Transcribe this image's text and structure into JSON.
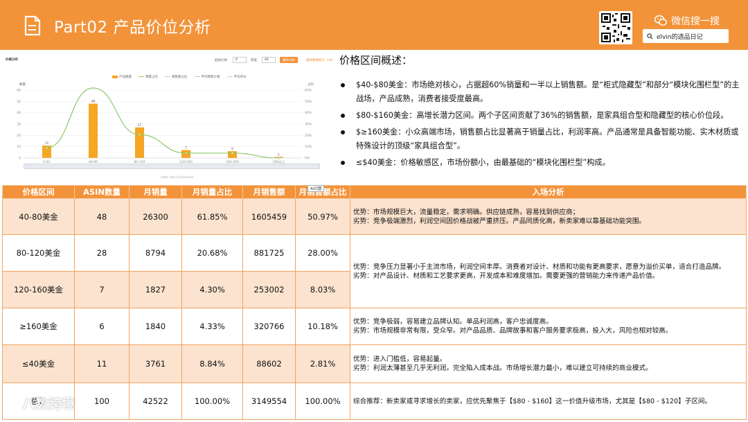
{
  "header": {
    "title": "Part02 产品价位分析",
    "wechat_label": "微信搜一搜",
    "search_text": "elvin的选品日记"
  },
  "chart_panel": {
    "toolbar_title": "价格分布",
    "ctrl1_label": "起始价格",
    "ctrl1_value": "0",
    "ctrl2_label": "跨度",
    "ctrl2_value": "40",
    "btn_label": "重新分析",
    "link_text": "箱体数据统计: 100",
    "left_axis_title": "数量",
    "right_axis_title": "占比",
    "footer_caption": "Litter Box Enclosures"
  },
  "chart_data": {
    "type": "bar",
    "categories": [
      "0-40",
      "40-80",
      "80-120",
      "120-160",
      "160-200",
      "200以上"
    ],
    "series": [
      {
        "name": "产品数量",
        "type": "bar",
        "values": [
          11,
          48,
          27,
          7,
          6,
          1
        ],
        "color": "#f5a623"
      },
      {
        "name": "销量占比",
        "type": "line",
        "values": [
          8.84,
          61.85,
          20.68,
          4.3,
          4.33,
          0
        ],
        "color": "#8fc96a"
      }
    ],
    "legend_extra": [
      "销售额占比",
      "平均销售价格",
      "平均评分"
    ],
    "y_left_ticks": [
      "60",
      "50",
      "40",
      "30",
      "20",
      "10",
      "0"
    ],
    "y_right_ticks": [
      "60%",
      "50%",
      "40%",
      "30%",
      "20%",
      "10%",
      "0%"
    ],
    "ylim_left": [
      0,
      60
    ],
    "ylim_right": [
      0,
      60
    ],
    "grid": true,
    "legend_position": "top-center"
  },
  "overview": {
    "title": "价格区间概述：",
    "bullets": [
      "$40-$80美金：市场绝对核心，占据超60%销量和一半以上销售额。是“柜式隐藏型”和部分“模块化围栏型”的主战场，产品成熟，消费者接受度最高。",
      "$80-$160美金：高增长潜力区间。两个子区间贡献了36%的销售额，是家具组合型和隐藏型的核心价位段。",
      "$≥160美金：小众高端市场，销售额占比显著高于销量占比，利润率高。产品通常是具备智能功能、实木材质或特殊设计的顶级“家具组合型”。",
      "≤$40美金：价格敏感区，市场份额小，由最基础的“模块化围栏型”构成。"
    ]
  },
  "table": {
    "headers": [
      "价格区间",
      "ASIN数量",
      "月销量",
      "月销量占比",
      "月销售额",
      "月销售额占比",
      "入场分析"
    ],
    "rows": [
      {
        "range": "40-80美金",
        "asin": "48",
        "units": "26300",
        "units_pct": "61.85%",
        "revenue": "1605459",
        "revenue_pct": "50.97%"
      },
      {
        "range": "80-120美金",
        "asin": "28",
        "units": "8794",
        "units_pct": "20.68%",
        "revenue": "881725",
        "revenue_pct": "28.00%"
      },
      {
        "range": "120-160美金",
        "asin": "7",
        "units": "1827",
        "units_pct": "4.30%",
        "revenue": "253002",
        "revenue_pct": "8.03%"
      },
      {
        "range": "≥160美金",
        "asin": "6",
        "units": "1840",
        "units_pct": "4.33%",
        "revenue": "320766",
        "revenue_pct": "10.18%"
      },
      {
        "range": "≤40美金",
        "asin": "11",
        "units": "3761",
        "units_pct": "8.84%",
        "revenue": "88602",
        "revenue_pct": "2.81%"
      },
      {
        "range": "总计",
        "asin": "100",
        "units": "42522",
        "units_pct": "100.00%",
        "revenue": "3149554",
        "revenue_pct": "100.00%"
      }
    ],
    "analysis": [
      {
        "a": "优势：市场规模巨大，流量稳定，需求明确。供应链成熟，容易找到供应商；",
        "b": "劣势：竞争极端激烈，利润空间因价格战被严重挤压。产品同质化高，新卖家难以靠基础功能突围。"
      },
      {
        "a": "优势：竞争压力显著小于主流市场，利润空间丰厚。消费者对设计、材质和功能有更高要求，愿意为溢价买单，适合打造品牌。",
        "b": "劣势：对产品设计、材质和工艺要求更高，开发成本和难度增加。需要更强的营销能力来传递产品价值。"
      },
      {
        "a": "优势：竞争极弱，容易建立品牌认知。单品利润高，客户忠诚度高。",
        "b": "劣势：市场规模非常有限，受众窄。对产品品质、品牌故事和客户服务要求极高，投入大，风险也相对较高。"
      },
      {
        "a": "优势：进入门槛低，容易起量。",
        "b": "劣势：利润太薄甚至几乎无利润，完全陷入成本战。市场增长潜力最小，难以建立可持续的商业模式。"
      },
      {
        "a": "综合推荐：新卖家或寻求增长的卖家，应优先聚焦于【$80 - $160】这一价值升级市场，尤其是【$80 - $120】子区间。"
      }
    ]
  },
  "float_tag": "AI识图",
  "watermark": "八数跨境"
}
